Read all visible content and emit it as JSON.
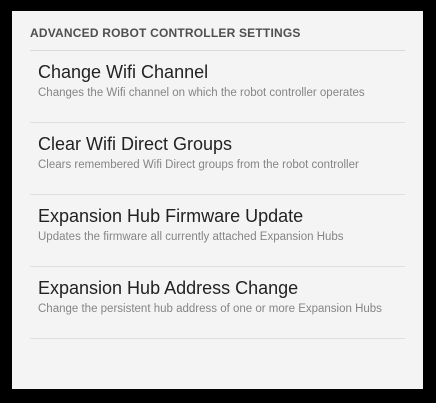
{
  "section": {
    "header": "ADVANCED ROBOT CONTROLLER SETTINGS"
  },
  "preferences": [
    {
      "title": "Change Wifi Channel",
      "summary": "Changes the Wifi channel on which the robot controller operates"
    },
    {
      "title": "Clear Wifi Direct Groups",
      "summary": "Clears remembered Wifi Direct groups from the robot controller"
    },
    {
      "title": "Expansion Hub Firmware Update",
      "summary": "Updates the firmware all currently attached Expansion Hubs"
    },
    {
      "title": "Expansion Hub Address Change",
      "summary": "Change the persistent hub address of one or more Expansion Hubs"
    }
  ],
  "colors": {
    "background": "#f4f4f4",
    "title_text": "#222222",
    "summary_text": "#858585",
    "header_text": "#4f4f4f",
    "divider": "#e0e0e0"
  }
}
